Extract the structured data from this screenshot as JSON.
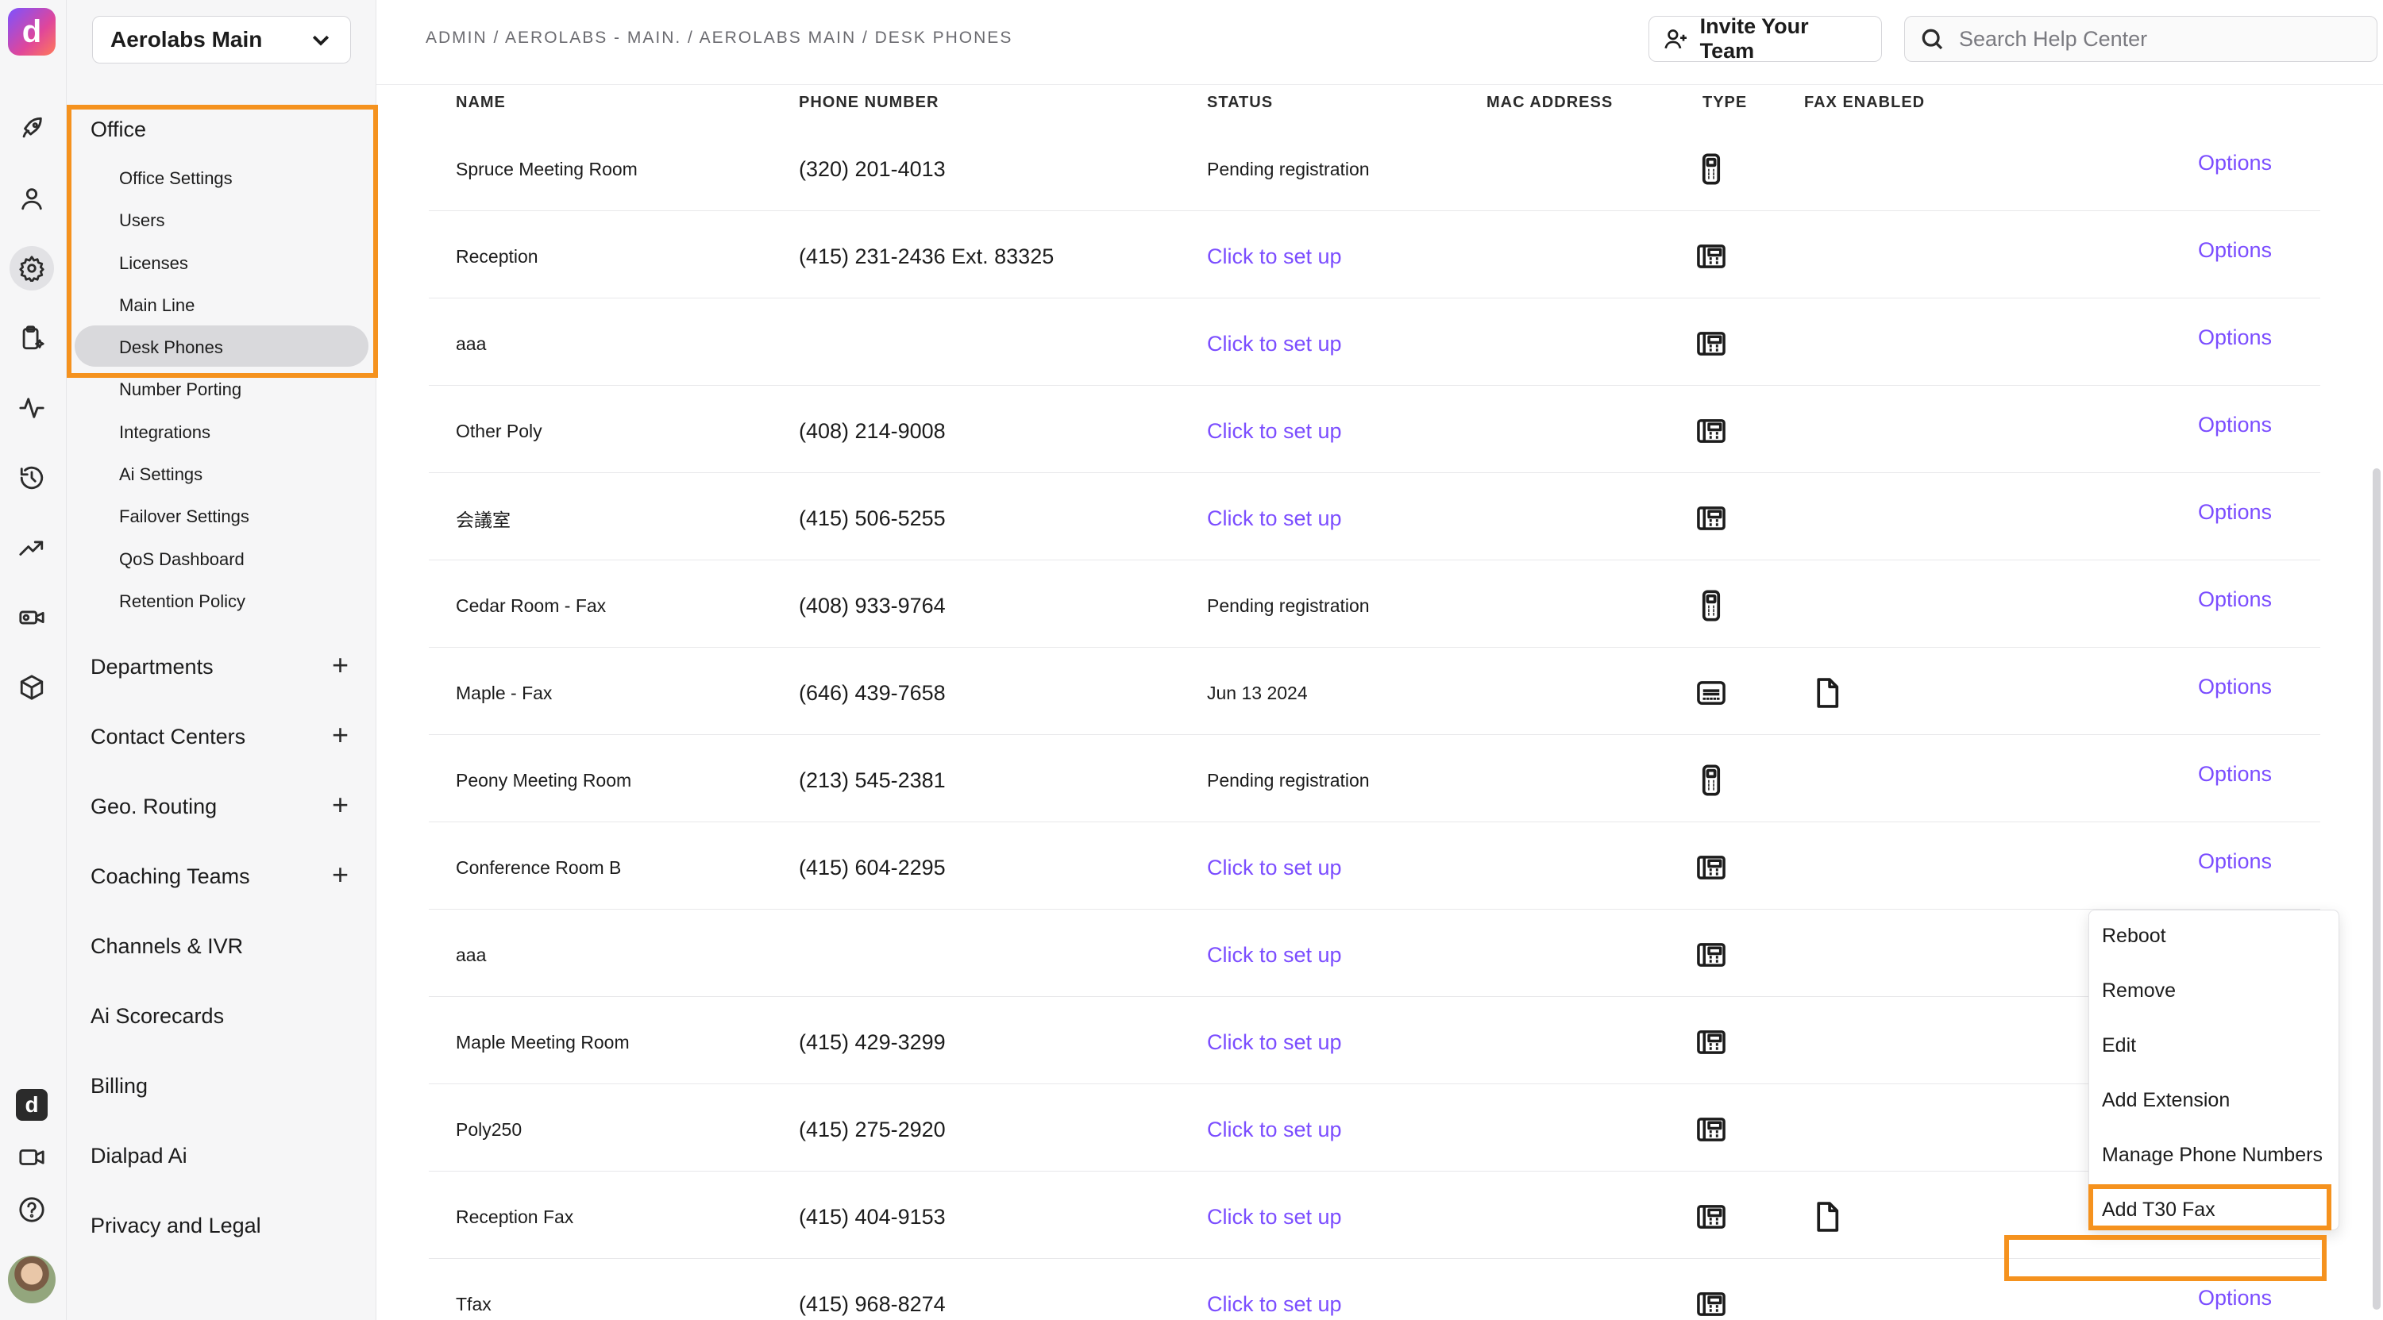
{
  "rail": {
    "icons": [
      "dialpad-logo-icon",
      "rocket-icon",
      "user-icon",
      "gear-icon",
      "clipboard-sparkle-icon",
      "activity-icon",
      "history-icon",
      "trending-up-icon",
      "video-ai-icon",
      "cube-icon",
      "dialpad-app-icon",
      "video-camera-icon",
      "help-circle-icon",
      "avatar"
    ]
  },
  "sidebar": {
    "office_select": "Aerolabs Main",
    "office_title": "Office",
    "office_items": [
      "Office Settings",
      "Users",
      "Licenses",
      "Main Line",
      "Desk Phones",
      "Number Porting",
      "Integrations",
      "Ai Settings",
      "Failover Settings",
      "QoS Dashboard",
      "Retention Policy"
    ],
    "sections": [
      "Departments",
      "Contact Centers",
      "Geo. Routing",
      "Coaching Teams",
      "Channels & IVR",
      "Ai Scorecards",
      "Billing",
      "Dialpad Ai",
      "Privacy and Legal"
    ]
  },
  "header": {
    "breadcrumb": "ADMIN / AEROLABS - MAIN. / AEROLABS MAIN / DESK PHONES",
    "invite_label": "Invite Your Team",
    "search_placeholder": "Search Help Center"
  },
  "table": {
    "columns": [
      "NAME",
      "PHONE NUMBER",
      "STATUS",
      "MAC ADDRESS",
      "TYPE",
      "FAX ENABLED"
    ],
    "options_label": "Options",
    "rows": [
      {
        "name": "Spruce Meeting Room",
        "phone": "(320) 201-4013",
        "status": "Pending registration",
        "status_link": false,
        "type": "handset-icon",
        "fax": false,
        "options": true
      },
      {
        "name": "Reception",
        "phone": "(415) 231-2436 Ext. 83325",
        "status": "Click to set up",
        "status_link": true,
        "type": "desk-phone-icon",
        "fax": false,
        "options": true
      },
      {
        "name": "aaa",
        "phone": "",
        "status": "Click to set up",
        "status_link": true,
        "type": "desk-phone-icon",
        "fax": false,
        "options": true
      },
      {
        "name": "Other Poly",
        "phone": "(408) 214-9008",
        "status": "Click to set up",
        "status_link": true,
        "type": "desk-phone-icon",
        "fax": false,
        "options": true
      },
      {
        "name": "会議室",
        "phone": "(415) 506-5255",
        "status": "Click to set up",
        "status_link": true,
        "type": "desk-phone-icon",
        "fax": false,
        "options": true
      },
      {
        "name": "Cedar Room - Fax",
        "phone": "(408) 933-9764",
        "status": "Pending registration",
        "status_link": false,
        "type": "handset-icon",
        "fax": false,
        "options": true
      },
      {
        "name": "Maple - Fax",
        "phone": "(646) 439-7658",
        "status": "Jun 13 2024",
        "status_link": false,
        "type": "fax-adapter-icon",
        "fax": true,
        "options": true
      },
      {
        "name": "Peony Meeting Room",
        "phone": "(213) 545-2381",
        "status": "Pending registration",
        "status_link": false,
        "type": "handset-icon",
        "fax": false,
        "options": true
      },
      {
        "name": "Conference Room B",
        "phone": "(415) 604-2295",
        "status": "Click to set up",
        "status_link": true,
        "type": "desk-phone-icon",
        "fax": false,
        "options": true
      },
      {
        "name": "aaa",
        "phone": "",
        "status": "Click to set up",
        "status_link": true,
        "type": "desk-phone-icon",
        "fax": false,
        "options": false
      },
      {
        "name": "Maple Meeting Room",
        "phone": "(415) 429-3299",
        "status": "Click to set up",
        "status_link": true,
        "type": "desk-phone-icon",
        "fax": false,
        "options": false
      },
      {
        "name": "Poly250",
        "phone": "(415) 275-2920",
        "status": "Click to set up",
        "status_link": true,
        "type": "desk-phone-icon",
        "fax": false,
        "options": false
      },
      {
        "name": "Reception Fax",
        "phone": "(415) 404-9153",
        "status": "Click to set up",
        "status_link": true,
        "type": "desk-phone-icon",
        "fax": true,
        "options": false
      },
      {
        "name": "Tfax",
        "phone": "(415) 968-8274",
        "status": "Click to set up",
        "status_link": true,
        "type": "desk-phone-icon",
        "fax": false,
        "options": true
      }
    ]
  },
  "menu": {
    "items": [
      "Reboot",
      "Remove",
      "Edit",
      "Add Extension",
      "Manage Phone Numbers",
      "Add T30 Fax"
    ]
  },
  "colors": {
    "accent": "#7b4dff",
    "highlight": "#f5921e"
  }
}
